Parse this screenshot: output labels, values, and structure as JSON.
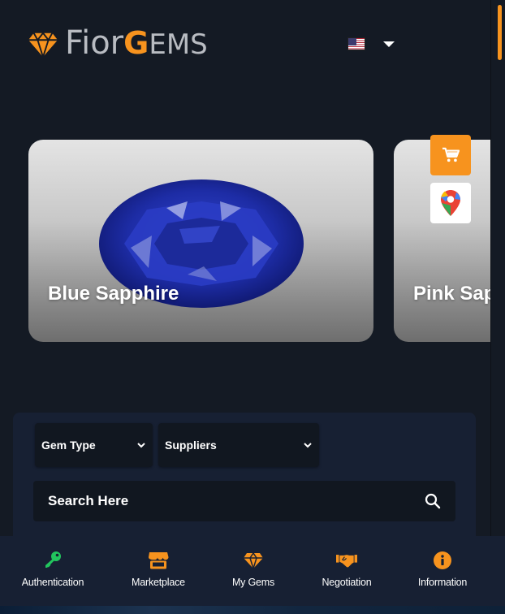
{
  "header": {
    "logo_fior": "Fior",
    "logo_g": "G",
    "logo_ems": "EMS",
    "language_flag": "us-flag-icon"
  },
  "carousel": {
    "cards": [
      {
        "title": "Blue Sapphire",
        "gem_color": "#1a2a9e"
      },
      {
        "title": "Pink Sap"
      }
    ]
  },
  "floating_actions": {
    "cart_icon": "cart-icon",
    "map_icon": "google-maps-icon"
  },
  "filters": {
    "gem_type_label": "Gem Type",
    "suppliers_label": "Suppliers",
    "search_placeholder": "Search Here"
  },
  "bottom_nav": {
    "items": [
      {
        "label": "Authentication",
        "icon": "key-icon",
        "color": "#22c55e"
      },
      {
        "label": "Marketplace",
        "icon": "store-icon",
        "color": "#f7931e"
      },
      {
        "label": "My Gems",
        "icon": "diamond-icon",
        "color": "#f7931e"
      },
      {
        "label": "Negotiation",
        "icon": "handshake-icon",
        "color": "#f7931e"
      },
      {
        "label": "Information",
        "icon": "info-icon",
        "color": "#f7931e"
      }
    ]
  },
  "colors": {
    "accent": "#f7931e",
    "background": "#141a24",
    "panel": "#172033"
  }
}
